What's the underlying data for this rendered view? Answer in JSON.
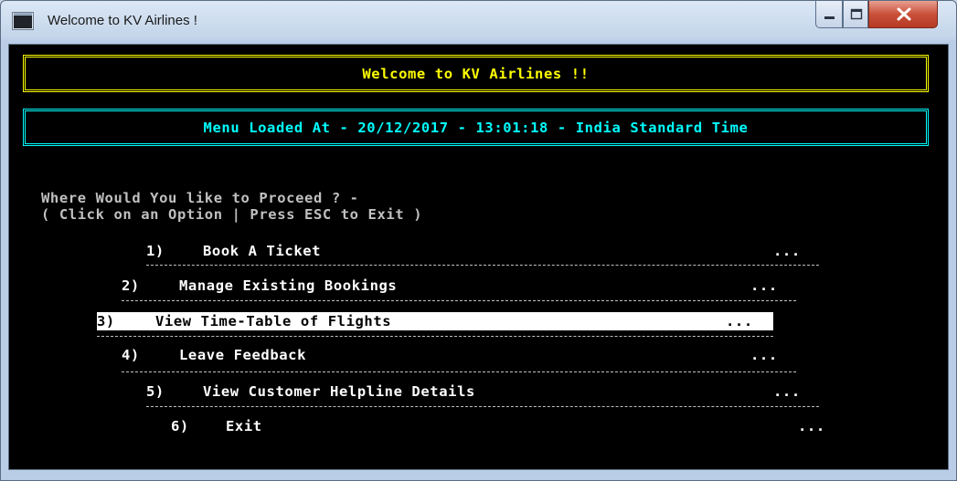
{
  "window": {
    "title": "Welcome to KV Airlines !"
  },
  "console": {
    "banner_welcome": "Welcome to KV Airlines !!",
    "banner_time": "Menu Loaded At - 20/12/2017 - 13:01:18 - India Standard Time",
    "prompt_line1": "Where Would You like to Proceed ? -",
    "prompt_line2": "( Click on an Option | Press ESC to Exit )",
    "menu": [
      {
        "num": "1)",
        "label": "Book A Ticket",
        "dots": "..."
      },
      {
        "num": "2)",
        "label": "Manage Existing Bookings",
        "dots": "..."
      },
      {
        "num": "3)",
        "label": "View Time-Table of Flights",
        "dots": "..."
      },
      {
        "num": "4)",
        "label": "Leave Feedback",
        "dots": "..."
      },
      {
        "num": "5)",
        "label": "View Customer Helpline Details",
        "dots": "..."
      },
      {
        "num": "6)",
        "label": "Exit",
        "dots": "..."
      }
    ],
    "selected_index": 2
  },
  "colors": {
    "console_bg": "#000000",
    "banner_welcome": "#ffff00",
    "banner_time": "#00ffff",
    "menu_text": "#ffffff",
    "prompt_text": "#c0c0c0",
    "selection_bg": "#ffffff"
  }
}
